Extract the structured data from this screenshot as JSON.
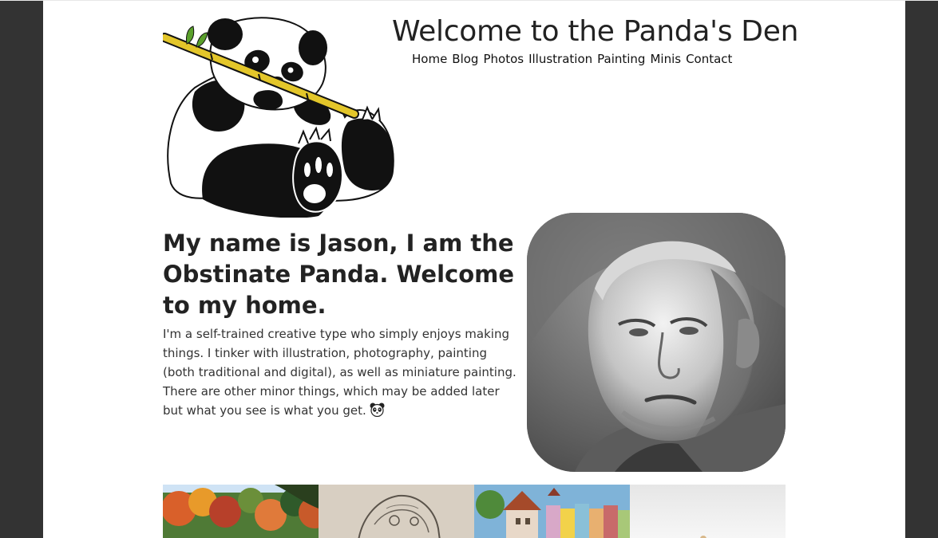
{
  "header": {
    "title": "Welcome to the Panda's Den",
    "logo_icon": "panda-eating-bamboo-icon"
  },
  "nav": {
    "items": [
      {
        "label": "Home"
      },
      {
        "label": "Blog"
      },
      {
        "label": "Photos"
      },
      {
        "label": "Illustration"
      },
      {
        "label": "Painting"
      },
      {
        "label": "Minis"
      },
      {
        "label": "Contact"
      }
    ]
  },
  "intro": {
    "heading": "My name is Jason, I am the Obstinate Panda. Welcome to my home.",
    "body": "I'm a self-trained creative type who simply enjoys making things. I tinker with illustration, photography, painting (both traditional and digital), as well as miniature painting. There are other minor things, which may be added later but what you see is what you get.",
    "emoji_icon": "panda-face-icon"
  },
  "portrait": {
    "description_icon": "grayscale-portrait-painting"
  },
  "gallery": {
    "items": [
      {
        "name": "autumn-forest-photo"
      },
      {
        "name": "sketch-illustration"
      },
      {
        "name": "town-painting"
      },
      {
        "name": "mini-photo"
      }
    ]
  },
  "colors": {
    "outer_background": "#333333",
    "page_background": "#ffffff",
    "bamboo": "#e3c62a",
    "leaf": "#5aa02c"
  }
}
